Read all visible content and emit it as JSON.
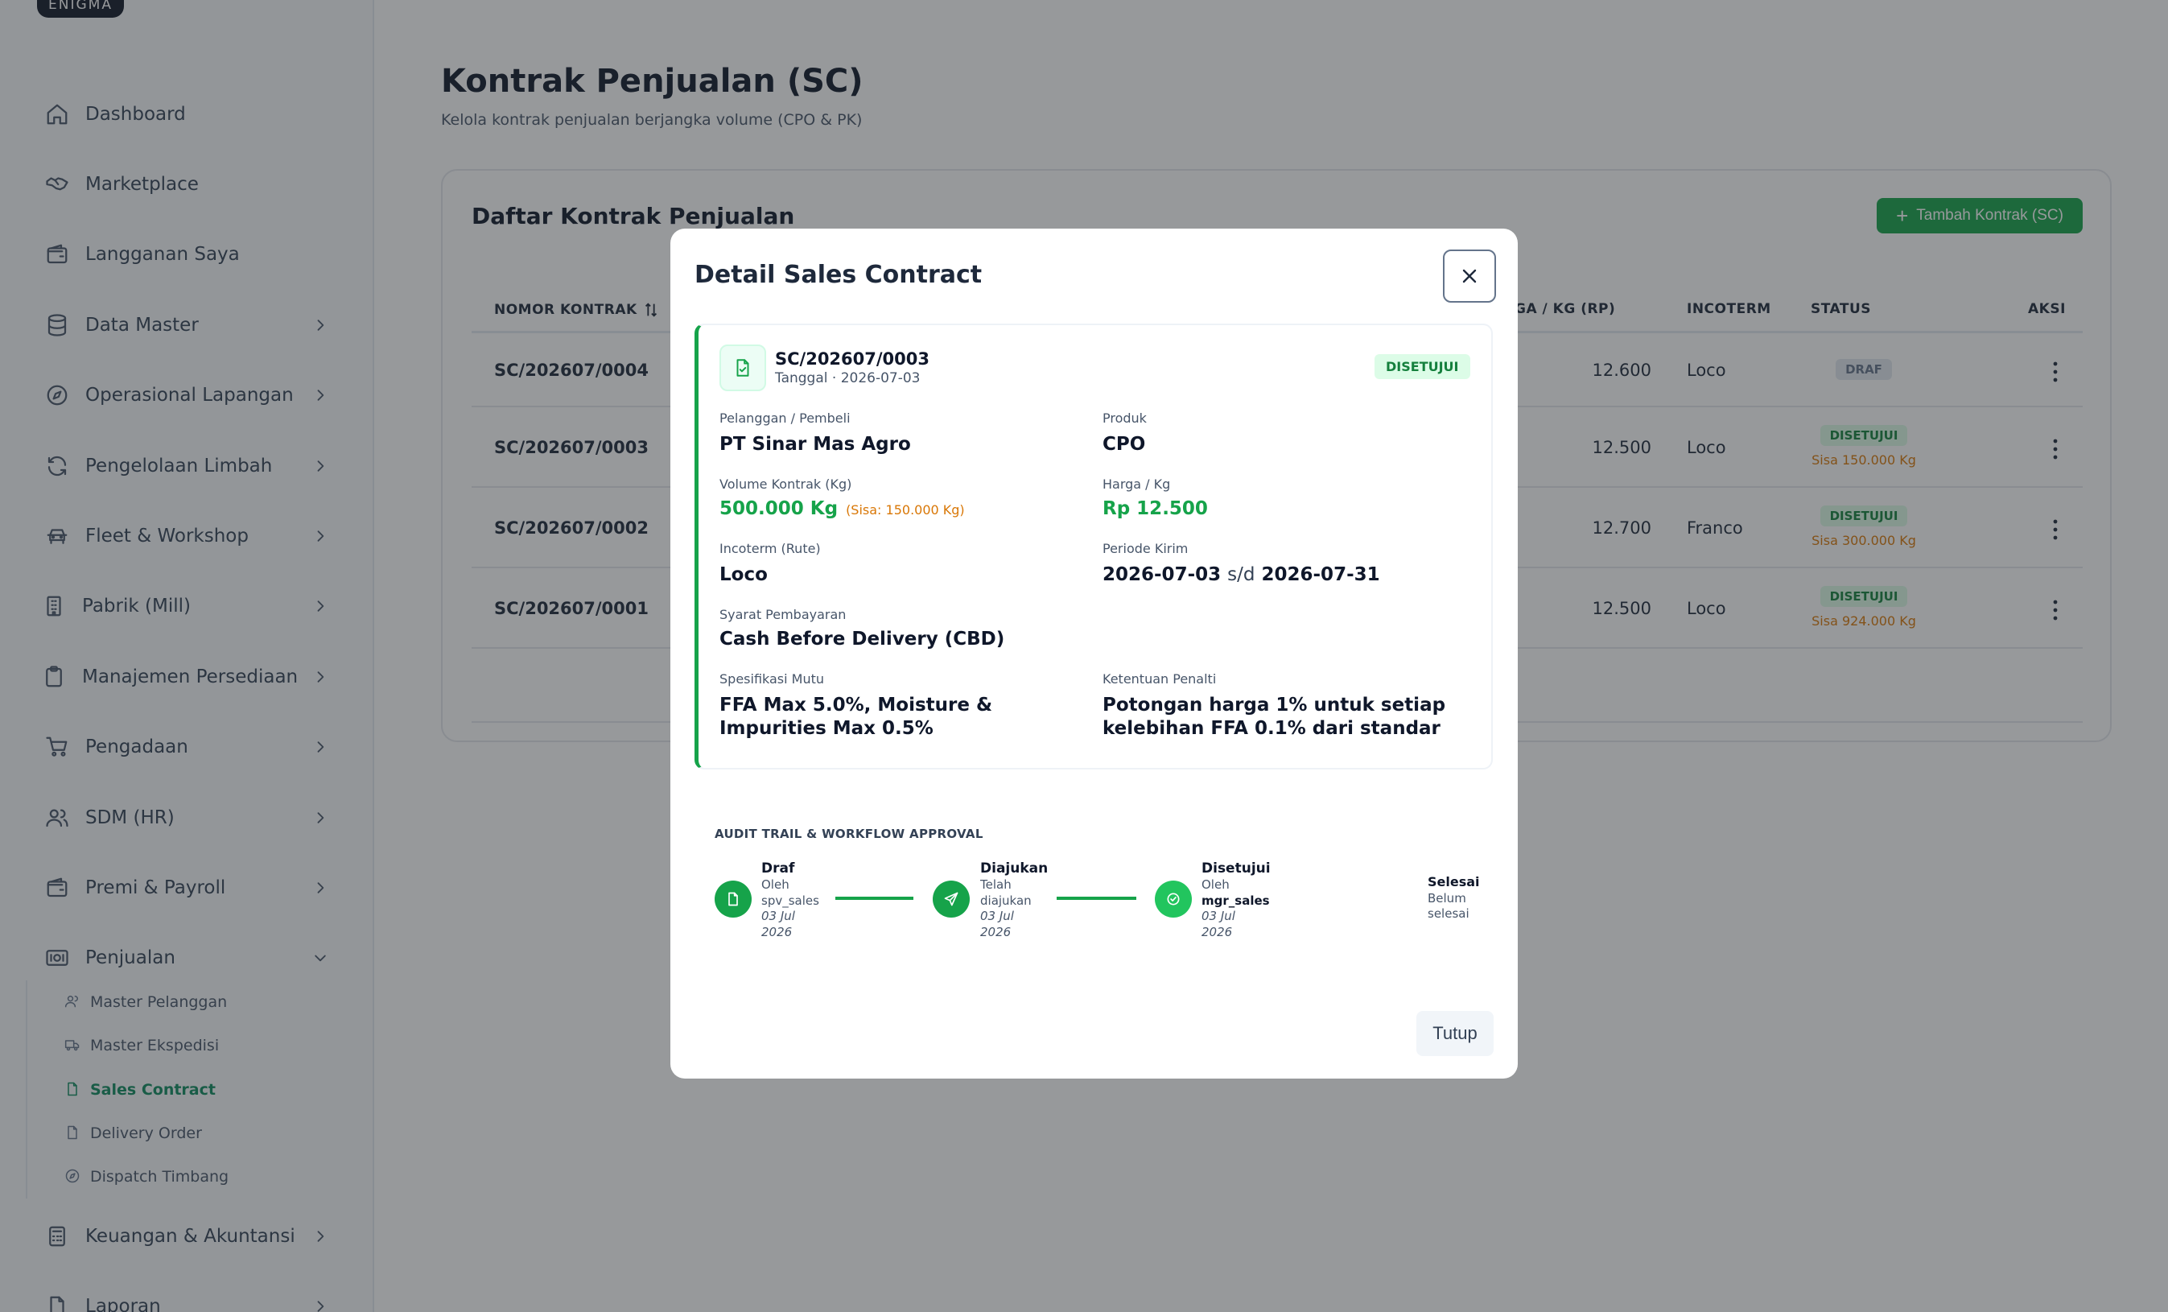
{
  "brand": "ENIGMA",
  "sidebar": {
    "items": [
      {
        "label": "Dashboard",
        "icon": "home-icon",
        "chevron": ""
      },
      {
        "label": "Marketplace",
        "icon": "handshake-icon",
        "chevron": ""
      },
      {
        "label": "Langganan Saya",
        "icon": "wallet-icon",
        "chevron": ""
      },
      {
        "label": "Data Master",
        "icon": "database-icon",
        "chevron": "right"
      },
      {
        "label": "Operasional Lapangan",
        "icon": "compass-icon",
        "chevron": "right"
      },
      {
        "label": "Pengelolaan Limbah",
        "icon": "recycle-icon",
        "chevron": "right"
      },
      {
        "label": "Fleet & Workshop",
        "icon": "car-icon",
        "chevron": "right"
      },
      {
        "label": "Pabrik (Mill)",
        "icon": "building-icon",
        "chevron": "right"
      },
      {
        "label": "Manajemen Persediaan",
        "icon": "clipboard-icon",
        "chevron": "right"
      },
      {
        "label": "Pengadaan",
        "icon": "cart-icon",
        "chevron": "right"
      },
      {
        "label": "SDM (HR)",
        "icon": "users-icon",
        "chevron": "right"
      },
      {
        "label": "Premi & Payroll",
        "icon": "wallet-icon",
        "chevron": "right"
      },
      {
        "label": "Penjualan",
        "icon": "banknote-icon",
        "chevron": "down"
      }
    ],
    "sub_items": [
      {
        "label": "Master Pelanggan",
        "icon": "users-icon",
        "active": false
      },
      {
        "label": "Master Ekspedisi",
        "icon": "truck-icon",
        "active": false
      },
      {
        "label": "Sales Contract",
        "icon": "file-icon",
        "active": true
      },
      {
        "label": "Delivery Order",
        "icon": "file-icon",
        "active": false
      },
      {
        "label": "Dispatch Timbang",
        "icon": "compass-icon",
        "active": false
      }
    ],
    "bottom_items": [
      {
        "label": "Keuangan & Akuntansi",
        "icon": "calculator-icon",
        "chevron": "right"
      },
      {
        "label": "Laporan",
        "icon": "file-icon",
        "chevron": "right"
      }
    ]
  },
  "page": {
    "title": "Kontrak Penjualan (SC)",
    "subtitle": "Kelola kontrak penjualan berjangka volume (CPO & PK)"
  },
  "card": {
    "title": "Daftar Kontrak Penjualan",
    "add_button": "Tambah Kontrak (SC)"
  },
  "table": {
    "headers": {
      "no": "NOMOR KONTRAK",
      "price": "GA / KG (RP)",
      "incoterm": "INCOTERM",
      "status": "STATUS",
      "action": "AKSI"
    },
    "rows": [
      {
        "no": "SC/202607/0004",
        "price": "12.600",
        "incoterm": "Loco",
        "status": "DRAF",
        "status_type": "draf",
        "sisa": ""
      },
      {
        "no": "SC/202607/0003",
        "price": "12.500",
        "incoterm": "Loco",
        "status": "DISETUJUI",
        "status_type": "ok",
        "sisa": "Sisa 150.000 Kg"
      },
      {
        "no": "SC/202607/0002",
        "price": "12.700",
        "incoterm": "Franco",
        "status": "DISETUJUI",
        "status_type": "ok",
        "sisa": "Sisa 300.000 Kg"
      },
      {
        "no": "SC/202607/0001",
        "price": "12.500",
        "incoterm": "Loco",
        "status": "DISETUJUI",
        "status_type": "ok",
        "sisa": "Sisa 924.000 Kg"
      }
    ]
  },
  "modal": {
    "title": "Detail Sales Contract",
    "contract_no": "SC/202607/0003",
    "contract_date": "Tanggal · 2026-07-03",
    "status": "DISETUJUI",
    "fields": {
      "customer_label": "Pelanggan / Pembeli",
      "customer": "PT Sinar Mas Agro",
      "product_label": "Produk",
      "product": "CPO",
      "volume_label": "Volume Kontrak (Kg)",
      "volume": "500.000 Kg",
      "volume_sisa": "(Sisa: 150.000 Kg)",
      "price_label": "Harga / Kg",
      "price": "Rp 12.500",
      "incoterm_label": "Incoterm (Rute)",
      "incoterm": "Loco",
      "period_label": "Periode Kirim",
      "period_start": "2026-07-03",
      "period_sep": "s/d",
      "period_end": "2026-07-31",
      "payment_label": "Syarat Pembayaran",
      "payment": "Cash Before Delivery (CBD)",
      "quality_label": "Spesifikasi Mutu",
      "quality": "FFA Max 5.0%, Moisture & Impurities Max 0.5%",
      "penalty_label": "Ketentuan Penalti",
      "penalty": "Potongan harga 1% untuk setiap kelebihan FFA 0.1% dari standar"
    },
    "audit_title": "AUDIT TRAIL & WORKFLOW APPROVAL",
    "steps": [
      {
        "title": "Draf",
        "line1": "Oleh",
        "line2": "spv_sales",
        "date1": "03 Jul",
        "date2": "2026"
      },
      {
        "title": "Diajukan",
        "line1": "Telah",
        "line2": "diajukan",
        "date1": "03 Jul",
        "date2": "2026"
      },
      {
        "title": "Disetujui",
        "line1": "Oleh",
        "line2": "mgr_sales",
        "date1": "03 Jul",
        "date2": "2026"
      },
      {
        "title": "Selesai",
        "line1": "Belum",
        "line2": "selesai",
        "date1": "",
        "date2": ""
      }
    ],
    "close_button": "Tutup"
  },
  "colors": {
    "accent": "#16a34a",
    "warning": "#d97706",
    "overlay": "rgba(38,42,46,0.48)"
  }
}
